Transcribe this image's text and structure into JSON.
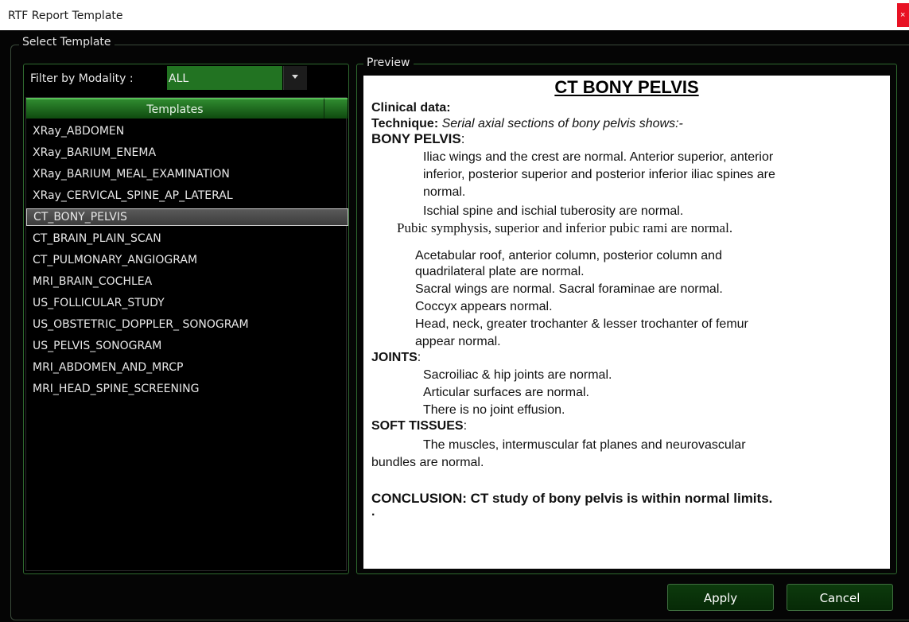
{
  "window": {
    "title": "RTF Report Template",
    "close_glyph": "×"
  },
  "group": {
    "legend": "Select Template"
  },
  "filter": {
    "label": "Filter by Modality :",
    "value": "ALL"
  },
  "templates": {
    "header": "Templates",
    "items": [
      "XRay_ABDOMEN",
      "XRay_BARIUM_ENEMA",
      "XRay_BARIUM_MEAL_EXAMINATION",
      "XRay_CERVICAL_SPINE_AP_LATERAL",
      "CT_BONY_PELVIS",
      "CT_BRAIN_PLAIN_SCAN",
      "CT_PULMONARY_ANGIOGRAM",
      "MRI_BRAIN_COCHLEA",
      "US_FOLLICULAR_STUDY",
      "US_OBSTETRIC_DOPPLER_ SONOGRAM",
      "US_PELVIS_SONOGRAM",
      "MRI_ABDOMEN_AND_MRCP",
      "MRI_HEAD_SPINE_SCREENING"
    ],
    "selected": "CT_BONY_PELVIS"
  },
  "preview": {
    "legend": "Preview",
    "title": "CT BONY PELVIS",
    "clinical_label": "Clinical data:",
    "technique_label": "Technique:",
    "technique_text": " Serial axial sections of bony pelvis shows:-",
    "bony_heading": "BONY PELVIS",
    "bony_l1": "Iliac wings and the crest are normal. Anterior superior, anterior",
    "bony_l2": "inferior, posterior superior and posterior inferior iliac spines are",
    "bony_l3": "normal.",
    "bony_l4": "Ischial spine and ischial tuberosity are normal.",
    "bony_l5": "Pubic symphysis, superior and inferior pubic rami are normal.",
    "bony_l6": "Acetabular roof, anterior column, posterior column and",
    "bony_l7": "quadrilateral plate are normal.",
    "bony_l8": "Sacral wings are normal. Sacral foraminae are normal.",
    "bony_l9": "Coccyx appears normal.",
    "bony_l10": "Head, neck, greater trochanter & lesser trochanter of femur",
    "bony_l11": "appear normal.",
    "joints_heading": "JOINTS",
    "joints_l1": "Sacroiliac & hip joints are normal.",
    "joints_l2": "Articular surfaces are normal.",
    "joints_l3": "There is no joint effusion.",
    "soft_heading": "SOFT TISSUES",
    "soft_l1": "The muscles, intermuscular fat planes and neurovascular",
    "soft_l2": "bundles are normal.",
    "conclusion": "CONCLUSION: CT study of bony pelvis is within normal limits.",
    "trailing": ".",
    "colon": ":"
  },
  "buttons": {
    "apply": "Apply",
    "cancel": "Cancel"
  }
}
